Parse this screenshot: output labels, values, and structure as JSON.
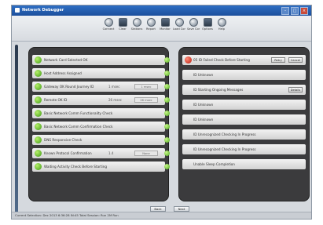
{
  "window": {
    "title": "Network Debugger"
  },
  "toolbar": [
    {
      "label": "Connect",
      "icon": "connect-icon"
    },
    {
      "label": "Clear",
      "icon": "clear-icon"
    },
    {
      "label": "Stations",
      "icon": "stations-icon"
    },
    {
      "label": "Report",
      "icon": "report-icon"
    },
    {
      "label": "Monitor",
      "icon": "monitor-icon"
    },
    {
      "label": "Load Config",
      "icon": "load-config-icon"
    },
    {
      "label": "Save Config",
      "icon": "save-config-icon"
    },
    {
      "label": "Options",
      "icon": "options-icon"
    },
    {
      "label": "Help",
      "icon": "help-icon"
    }
  ],
  "left_rows": [
    {
      "label": "Network Card Selected OK",
      "value": "",
      "field": ""
    },
    {
      "label": "Host Address Assigned",
      "value": "",
      "field": ""
    },
    {
      "label": "Gateway OK  Round Journey ID",
      "value": "1 msec",
      "field": "1 msec"
    },
    {
      "label": "Remote OK ID",
      "value": "26 msec",
      "field": "26 msec"
    },
    {
      "label": "Basic Network Comm Functionality Check",
      "value": "",
      "field": ""
    },
    {
      "label": "Basic Network Comm Confirmation Check",
      "value": "",
      "field": ""
    },
    {
      "label": "DNS Responsive Check",
      "value": "",
      "field": ""
    },
    {
      "label": "Known Protocol Confirmation",
      "value": "1.4",
      "field": "None"
    },
    {
      "label": "Waiting Activity Check Before Starting",
      "value": "",
      "field": ""
    }
  ],
  "right_rows": [
    {
      "label": "05  ID  Failed Check Before Starting",
      "buttons": [
        "Retry",
        "Cancel"
      ]
    },
    {
      "label": "ID  Unknown",
      "buttons": []
    },
    {
      "label": "ID  Starting Ongoing Messages",
      "buttons": [
        "Details"
      ]
    },
    {
      "label": "ID  Unknown",
      "buttons": []
    },
    {
      "label": "ID  Unknown",
      "buttons": []
    },
    {
      "label": "ID  Unrecognized Checking In Progress",
      "buttons": []
    },
    {
      "label": "ID  Unrecognized Checking In Progress",
      "buttons": []
    },
    {
      "label": "Unable Sleep Completion",
      "buttons": []
    }
  ],
  "buttons": {
    "back": "Back",
    "next": "Next"
  },
  "status": "Current Selection: Dec 2013 6:36:28 IN:45   Total Session: Run 2M Run"
}
